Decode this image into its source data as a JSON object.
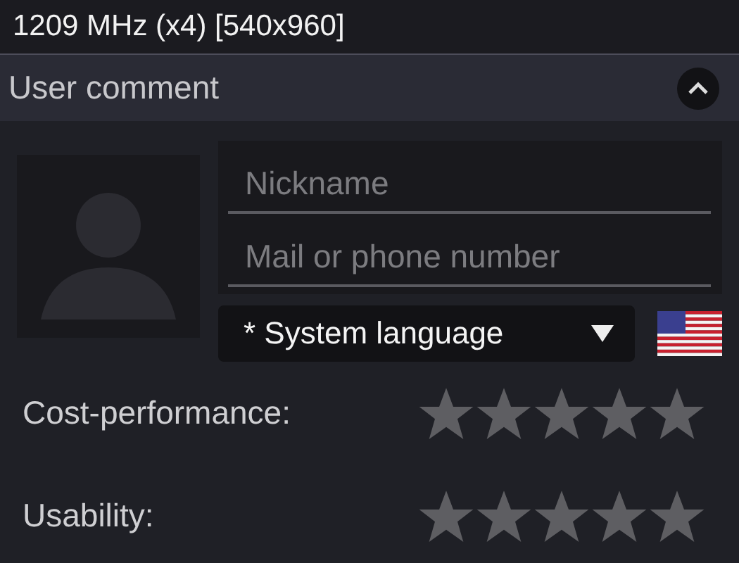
{
  "status_line": "1209 MHz (x4) [540x960]",
  "section": {
    "title": "User comment",
    "expanded": true
  },
  "form": {
    "nickname": {
      "placeholder": "Nickname"
    },
    "contact": {
      "placeholder": "Mail or phone number"
    },
    "language": {
      "value": "* System language"
    }
  },
  "ratings": [
    {
      "label": "Cost-performance:",
      "stars": 0
    },
    {
      "label": "Usability:",
      "stars": 0
    }
  ]
}
